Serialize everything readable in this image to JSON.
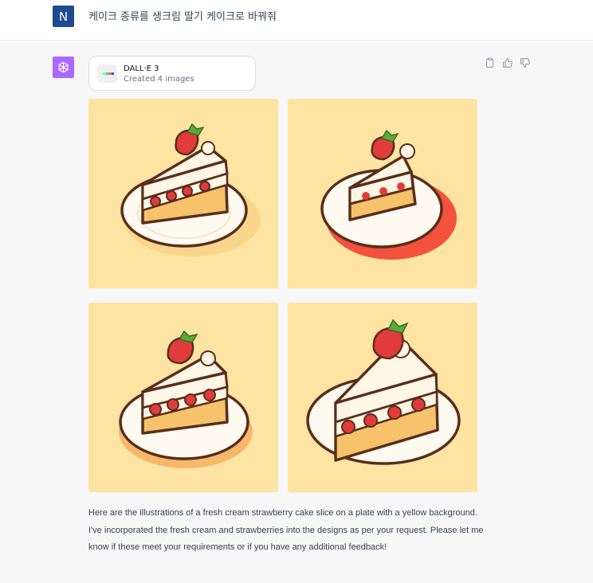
{
  "user": {
    "avatar_letter": "N",
    "message": "케이크 종류를 생크림 딸기 케이크로 바꿔줘"
  },
  "assistant": {
    "avatar_icon": "openai-logo-icon",
    "tool": {
      "name": "DALL·E 3",
      "status": "Created 4 images",
      "icon": "dalle-icon"
    },
    "actions": [
      "copy-icon",
      "thumbs-up-icon",
      "thumbs-down-icon"
    ],
    "images": [
      {
        "name": "generated-image-1",
        "variant": "front"
      },
      {
        "name": "generated-image-2",
        "variant": "shadow"
      },
      {
        "name": "generated-image-3",
        "variant": "front"
      },
      {
        "name": "generated-image-4",
        "variant": "tall"
      }
    ],
    "response_text": "Here are the illustrations of a fresh cream strawberry cake slice on a plate with a yellow background. I've incorporated the fresh cream and strawberries into the designs as per your request. Please let me know if these meet your requirements or if you have any additional feedback!"
  },
  "colors": {
    "user_avatar_bg": "#1d4b8f",
    "assistant_avatar_bg": "#ab68ff",
    "image_bg": "#fde4a3",
    "conversation_bg": "#f7f7f8"
  }
}
